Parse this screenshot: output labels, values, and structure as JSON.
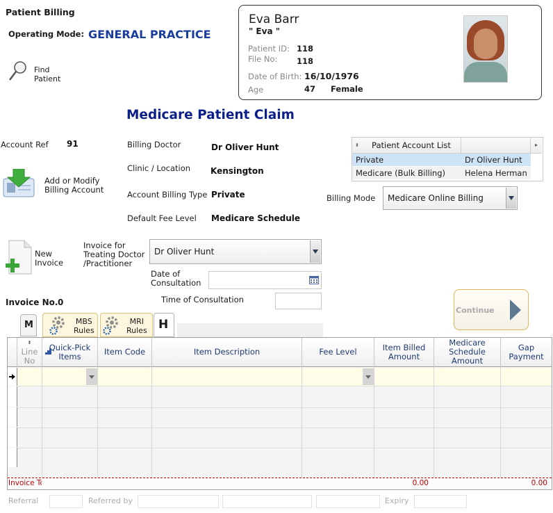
{
  "header": {
    "title": "Patient Billing",
    "operating_mode_label": "Operating Mode:",
    "operating_mode_value": "GENERAL PRACTICE",
    "find_patient_line1": "Find",
    "find_patient_line2": "Patient"
  },
  "patient": {
    "name": "Eva Barr",
    "nickname": "\" Eva \"",
    "patient_id_label": "Patient ID:",
    "patient_id": "118",
    "file_no_label": "File No:",
    "file_no": "118",
    "dob_label": "Date of Birth:",
    "dob": "16/10/1976",
    "age_label": "Age",
    "age": "47",
    "sex": "Female"
  },
  "page_title": "Medicare Patient Claim",
  "account": {
    "ref_label": "Account Ref",
    "ref_value": "91",
    "add_modify_line1": "Add or Modify",
    "add_modify_line2": "Billing Account",
    "billing_doctor_label": "Billing Doctor",
    "billing_doctor": "Dr Oliver Hunt",
    "clinic_label": "Clinic / Location",
    "clinic": "Kensington",
    "billing_type_label": "Account Billing Type",
    "billing_type": "Private",
    "fee_level_label": "Default Fee Level",
    "fee_level": "Medicare Schedule"
  },
  "account_list": {
    "header": "Patient Account List",
    "rows": [
      {
        "type": "Private",
        "doctor": "Dr Oliver Hunt"
      },
      {
        "type": "Medicare (Bulk Billing)",
        "doctor": "Helena Herman"
      }
    ]
  },
  "billing_mode": {
    "label": "Billing Mode",
    "value": "Medicare Online Billing"
  },
  "invoice": {
    "new_line1": "New",
    "new_line2": "Invoice",
    "for_line1": "Invoice for",
    "for_line2": "Treating Doctor",
    "for_line3": "/Practitioner",
    "doctor_value": "Dr Oliver Hunt",
    "date_label_line1": "Date of",
    "date_label_line2": "Consultation",
    "time_label": "Time of Consultation",
    "invoice_no_label": "Invoice No.",
    "invoice_no": "0",
    "continue_label": "Continue"
  },
  "tabs": {
    "m": "M",
    "mbs_line1": "MBS",
    "mbs_line2": "Rules",
    "mri_line1": "MRI",
    "mri_line2": "Rules",
    "h": "H"
  },
  "grid": {
    "headers": {
      "line_no_1": "Line",
      "line_no_2": "No",
      "quick_pick_1": "Quick-Pick",
      "quick_pick_2": "Items",
      "item_code": "Item Code",
      "item_description": "Item Description",
      "fee_level": "Fee Level",
      "billed_1": "Item Billed",
      "billed_2": "Amount",
      "schedule_1": "Medicare",
      "schedule_2": "Schedule",
      "schedule_3": "Amount",
      "gap_1": "Gap",
      "gap_2": "Payment"
    },
    "footer_label": "Invoice To",
    "footer_billed": "0.00",
    "footer_gap": "0.00"
  },
  "bottom": {
    "referral_label": "Referral",
    "referred_by_label": "Referred by",
    "expiry_label": "Expiry"
  },
  "colors": {
    "accent_blue": "#1a3c9c",
    "title_navy": "#0b1f8a",
    "footer_red": "#c00000"
  }
}
